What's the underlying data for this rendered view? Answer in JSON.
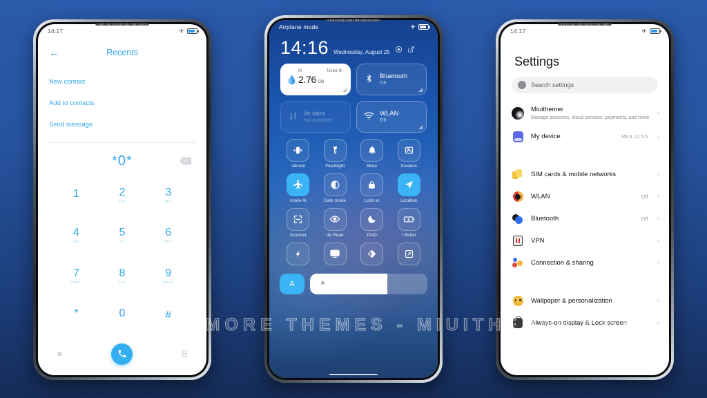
{
  "watermark": "VISIT FOR MORE THEMES - MIUITHEMER.COM",
  "colors": {
    "accent": "#33aef0",
    "background_top": "#2a5aab",
    "background_bottom": "#152c58",
    "toggle_on": "#3bb4f5"
  },
  "phone1": {
    "statusbar": {
      "time": "14:17",
      "airplane_icon": "airplane-mode-icon",
      "battery_icon": "battery-icon"
    },
    "header": {
      "back_icon": "back-arrow-icon",
      "title": "Recents"
    },
    "menu": [
      {
        "label": "New contact"
      },
      {
        "label": "Add to contacts"
      },
      {
        "label": "Send message"
      }
    ],
    "dial": {
      "number": "*0*",
      "delete_icon": "backspace-icon"
    },
    "keypad": [
      {
        "digit": "1",
        "letters": ""
      },
      {
        "digit": "2",
        "letters": "ABC"
      },
      {
        "digit": "3",
        "letters": "DEF"
      },
      {
        "digit": "4",
        "letters": "GHI"
      },
      {
        "digit": "5",
        "letters": "JKL"
      },
      {
        "digit": "6",
        "letters": "MNO"
      },
      {
        "digit": "7",
        "letters": "PQRS"
      },
      {
        "digit": "8",
        "letters": "TUV"
      },
      {
        "digit": "9",
        "letters": "WXYZ"
      },
      {
        "digit": "*",
        "letters": ","
      },
      {
        "digit": "0",
        "letters": "+"
      },
      {
        "digit": "#",
        "letters": ""
      }
    ],
    "footer": {
      "menu_icon": "≡",
      "call_icon": "✆",
      "dialpad_icon": "⌸"
    }
  },
  "phone2": {
    "statusbar": {
      "label": "Airplane mode",
      "airplane_icon": "airplane-mode-icon",
      "battery_icon": "battery-icon"
    },
    "clock": {
      "time": "14:16",
      "date": "Wednesday, August 25",
      "settings_icon": "◎",
      "edit_icon": "↗"
    },
    "cards": [
      {
        "id": "data-usage",
        "type": "data",
        "top_left": "th",
        "top_right": "Used th",
        "value": "2.76",
        "unit": "GB",
        "icon": "water-drop-icon"
      },
      {
        "id": "bluetooth",
        "type": "toggle",
        "title": "Bluetooth",
        "status": "Off",
        "icon": "bluetooth-icon",
        "enabled": false,
        "dim": false
      },
      {
        "id": "mobile-data",
        "type": "toggle",
        "title": "ile data",
        "status": "Not available",
        "icon": "mobile-data-icon",
        "enabled": false,
        "dim": true
      },
      {
        "id": "wlan",
        "type": "toggle",
        "title": "WLAN",
        "status": "Off",
        "icon": "wifi-icon",
        "enabled": false,
        "dim": false
      }
    ],
    "toggles": [
      {
        "label": "Vibrate",
        "icon": "vibrate-icon",
        "glyph": "◫",
        "on": false
      },
      {
        "label": "Flashlight",
        "icon": "flashlight-icon",
        "glyph": "⌇",
        "on": false
      },
      {
        "label": "Mute",
        "icon": "bell-icon",
        "glyph": "ὑ4",
        "on": false
      },
      {
        "label": "Screens",
        "icon": "screenshot-icon",
        "glyph": "⌧",
        "on": false
      },
      {
        "label": "mode    Ai",
        "icon": "airplane-icon",
        "glyph": "✈",
        "on": true
      },
      {
        "label": "Dark mode",
        "icon": "dark-mode-icon",
        "glyph": "◑",
        "on": false
      },
      {
        "label": "Lock sc",
        "icon": "lock-icon",
        "glyph": "ὑ2",
        "on": false
      },
      {
        "label": "Location",
        "icon": "location-icon",
        "glyph": "➤",
        "on": true
      },
      {
        "label": "Scanner",
        "icon": "scanner-icon",
        "glyph": "⬚",
        "on": false
      },
      {
        "label": "de   Read",
        "icon": "reading-mode-icon",
        "glyph": "◉",
        "on": false
      },
      {
        "label": "DND",
        "icon": "moon-icon",
        "glyph": "☾",
        "on": false
      },
      {
        "label": "r    Batter",
        "icon": "battery-saver-icon",
        "glyph": "ὐb",
        "on": false
      },
      {
        "label": "",
        "icon": "sync-icon",
        "glyph": "⚡",
        "on": false
      },
      {
        "label": "",
        "icon": "cast-icon",
        "glyph": "Ὓ5",
        "on": false
      },
      {
        "label": "",
        "icon": "theme-icon",
        "glyph": "◐",
        "on": false
      },
      {
        "label": "",
        "icon": "fullscreen-icon",
        "glyph": "⤢",
        "on": false
      }
    ],
    "brightness": {
      "auto_label": "A",
      "sun_icon": "brightness-icon",
      "level": 66
    }
  },
  "phone3": {
    "statusbar": {
      "time": "14:17",
      "airplane_icon": "airplane-mode-icon",
      "battery_icon": "battery-icon"
    },
    "title": "Settings",
    "search": {
      "placeholder": "Search settings",
      "icon": "search-icon"
    },
    "account": {
      "name": "Miuithemer",
      "subtitle": "Manage accounts, cloud services, payments, and more",
      "icon": "avatar"
    },
    "device": {
      "name": "My device",
      "value": "MIUI 12.5.5",
      "icon": "device-icon"
    },
    "items": [
      {
        "label": "SIM cards & mobile networks",
        "value": "",
        "icon": "sim-card-icon"
      },
      {
        "label": "WLAN",
        "value": "Off",
        "icon": "wlan-icon"
      },
      {
        "label": "Bluetooth",
        "value": "Off",
        "icon": "bluetooth-icon"
      },
      {
        "label": "VPN",
        "value": "",
        "icon": "vpn-icon"
      },
      {
        "label": "Connection & sharing",
        "value": "",
        "icon": "connection-sharing-icon"
      }
    ],
    "items2": [
      {
        "label": "Wallpaper & personalization",
        "value": "",
        "icon": "wallpaper-icon"
      },
      {
        "label": "Always-on display & Lock screen",
        "value": "",
        "icon": "aod-icon"
      }
    ],
    "chevron": "›"
  }
}
